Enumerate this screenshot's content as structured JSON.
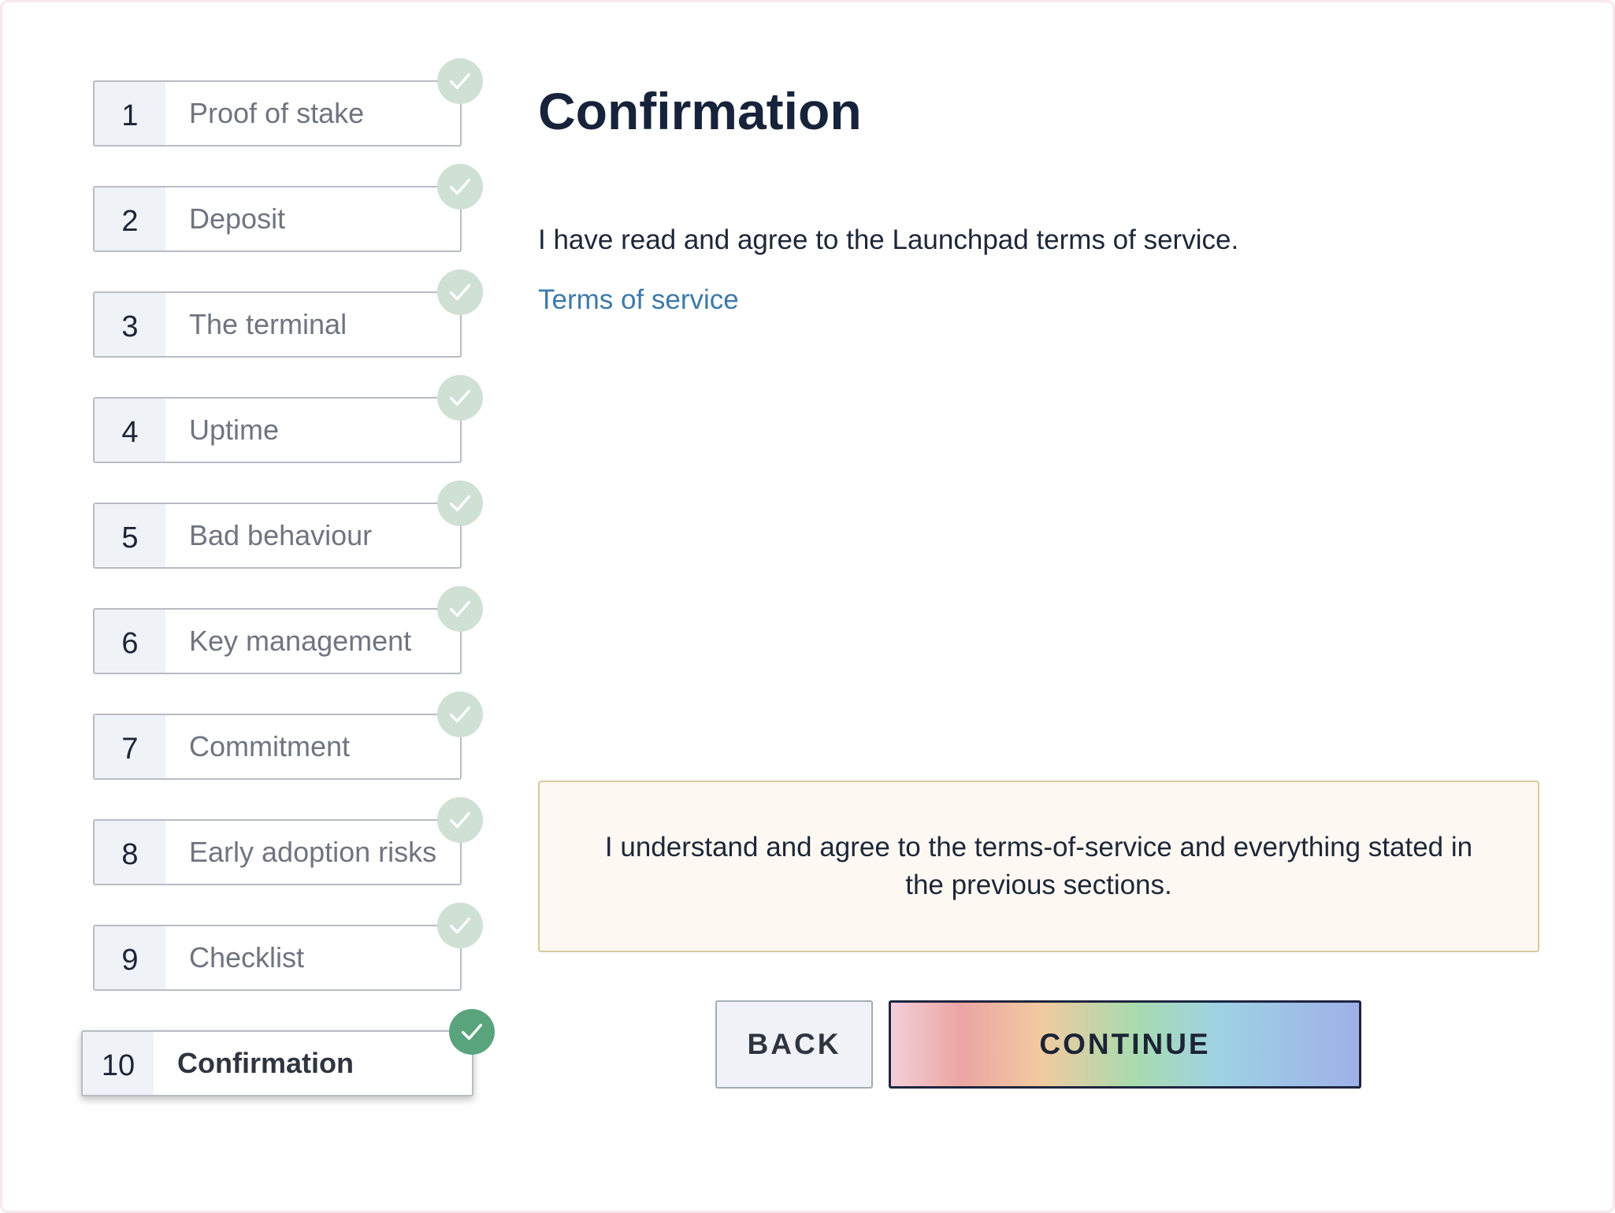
{
  "steps": [
    {
      "number": "1",
      "label": "Proof of stake"
    },
    {
      "number": "2",
      "label": "Deposit"
    },
    {
      "number": "3",
      "label": "The terminal"
    },
    {
      "number": "4",
      "label": "Uptime"
    },
    {
      "number": "5",
      "label": "Bad behaviour"
    },
    {
      "number": "6",
      "label": "Key management"
    },
    {
      "number": "7",
      "label": "Commitment"
    },
    {
      "number": "8",
      "label": "Early adoption risks"
    },
    {
      "number": "9",
      "label": "Checklist"
    },
    {
      "number": "10",
      "label": "Confirmation"
    }
  ],
  "main": {
    "title": "Confirmation",
    "agree_text": "I have read and agree to the Launchpad terms of service.",
    "tos_link": "Terms of service",
    "confirm_text": "I understand and agree to the terms-of-service and everything stated in the previous sections."
  },
  "buttons": {
    "back": "BACK",
    "continue": "CONTINUE"
  },
  "colors": {
    "check_done": "#cfe0d5",
    "check_active": "#5aa47d",
    "link": "#3c7aa8"
  },
  "icons": {
    "completed": "check-icon"
  }
}
